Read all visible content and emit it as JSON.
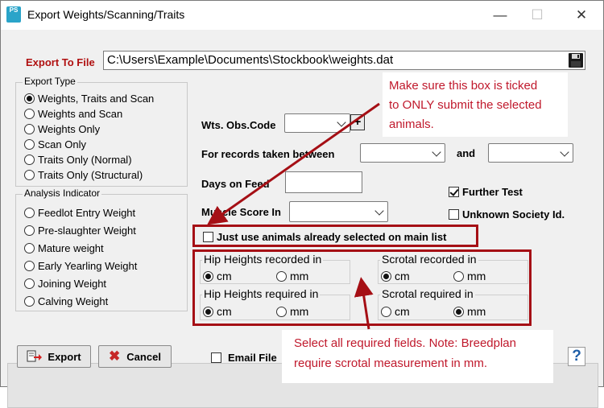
{
  "window": {
    "title": "Export Weights/Scanning/Traits",
    "app_icon_text": "PS",
    "minimize": "—",
    "maximize": "☐",
    "close": "✕"
  },
  "export_to_file": {
    "label": "Export To File",
    "value": "C:\\Users\\Example\\Documents\\Stockbook\\weights.dat"
  },
  "export_type": {
    "caption": "Export Type",
    "options": [
      "Weights, Traits and Scan",
      "Weights and Scan",
      "Weights Only",
      "Scan Only",
      "Traits Only (Normal)",
      "Traits Only (Structural)"
    ],
    "selected": "Weights, Traits and Scan"
  },
  "analysis_indicator": {
    "caption": "Analysis Indicator",
    "options": [
      "Feedlot Entry Weight",
      "Pre-slaughter Weight",
      "Mature weight",
      "Early Yearling Weight",
      "Joining Weight",
      "Calving Weight"
    ]
  },
  "form": {
    "wts_obs_code": "Wts. Obs.Code",
    "add_symbol": "+",
    "records_between": "For records taken between",
    "and": "and",
    "days_on_feed": "Days on Feed",
    "muscle_score": "Muscle Score In",
    "further_test": "Further Test",
    "unknown_society": "Unknown Society Id.",
    "just_use_selected": "Just use animals already selected on main list"
  },
  "units": {
    "hip_recorded": {
      "caption": "Hip Heights recorded in",
      "options": [
        "cm",
        "mm"
      ],
      "selected": "cm"
    },
    "scrotal_recorded": {
      "caption": "Scrotal recorded in",
      "options": [
        "cm",
        "mm"
      ],
      "selected": "cm"
    },
    "hip_required": {
      "caption": "Hip Heights required in",
      "options": [
        "cm",
        "mm"
      ],
      "selected": "cm"
    },
    "scrotal_required": {
      "caption": "Scrotal required in",
      "options": [
        "cm",
        "mm"
      ],
      "selected": "mm"
    }
  },
  "annotations": {
    "top_lines": [
      "Make sure this box is ticked",
      "to ONLY submit the selected",
      "animals."
    ],
    "bottom_lines": [
      "Select all required fields. Note: Breedplan",
      "require scrotal measurement in mm."
    ]
  },
  "bottom": {
    "export": "Export",
    "cancel": "Cancel",
    "email_file": "Email File",
    "help": "?"
  },
  "colors": {
    "annotation_red": "#c0192c",
    "box_red": "#a50f15",
    "label_red": "#b01010"
  }
}
